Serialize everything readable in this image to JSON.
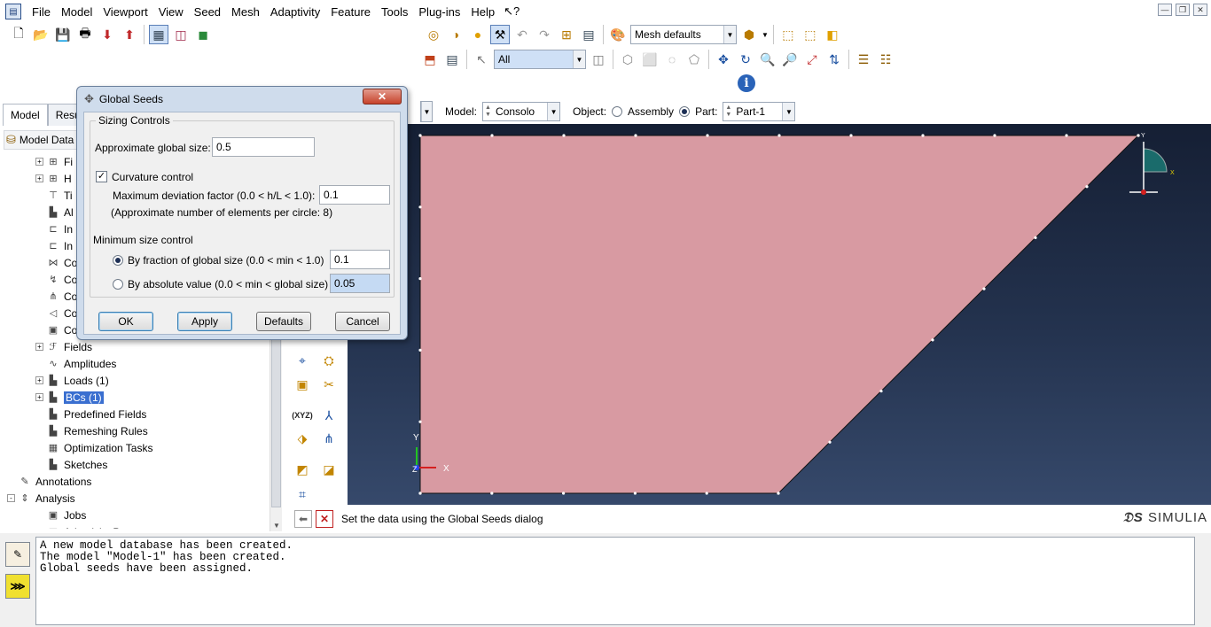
{
  "menu": [
    "File",
    "Model",
    "Viewport",
    "View",
    "Seed",
    "Mesh",
    "Adaptivity",
    "Feature",
    "Tools",
    "Plug-ins",
    "Help"
  ],
  "toolbar": {
    "mesh_defaults": "Mesh defaults",
    "selection_filter": "All"
  },
  "context_bar": {
    "model_label": "Model:",
    "model_value": "Consolo",
    "object_label": "Object:",
    "assembly_label": "Assembly",
    "part_label": "Part:",
    "part_value": "Part-1"
  },
  "left_panel": {
    "tabs": [
      "Model",
      "Resu"
    ],
    "tree_head": "Model Data",
    "tree": [
      {
        "label": "Fi",
        "indent": 1,
        "exp": "+",
        "icon": "step-icon"
      },
      {
        "label": "H",
        "indent": 1,
        "exp": "+",
        "icon": "history-icon"
      },
      {
        "label": "Ti",
        "indent": 1,
        "exp": "",
        "icon": "time-icon"
      },
      {
        "label": "Al",
        "indent": 1,
        "exp": "",
        "icon": "al-icon"
      },
      {
        "label": "In",
        "indent": 1,
        "exp": "",
        "icon": "interaction-icon"
      },
      {
        "label": "In",
        "indent": 1,
        "exp": "",
        "icon": "interaction-prop-icon"
      },
      {
        "label": "Co",
        "indent": 1,
        "exp": "",
        "icon": "constraint-icon"
      },
      {
        "label": "Co",
        "indent": 1,
        "exp": "",
        "icon": "connector-icon"
      },
      {
        "label": "Co",
        "indent": 1,
        "exp": "",
        "icon": "connector-section-icon"
      },
      {
        "label": "Co",
        "indent": 1,
        "exp": "",
        "icon": "contact-icon"
      },
      {
        "label": "Co",
        "indent": 1,
        "exp": "",
        "icon": "controls-icon"
      },
      {
        "label": "Fields",
        "indent": 1,
        "exp": "+",
        "icon": "fields-icon"
      },
      {
        "label": "Amplitudes",
        "indent": 1,
        "exp": "",
        "icon": "amplitude-icon"
      },
      {
        "label": "Loads (1)",
        "indent": 1,
        "exp": "+",
        "icon": "load-icon"
      },
      {
        "label": "BCs (1)",
        "indent": 1,
        "exp": "+",
        "icon": "bc-icon",
        "selected": true
      },
      {
        "label": "Predefined Fields",
        "indent": 1,
        "exp": "",
        "icon": "predefined-icon"
      },
      {
        "label": "Remeshing Rules",
        "indent": 1,
        "exp": "",
        "icon": "remesh-icon"
      },
      {
        "label": "Optimization Tasks",
        "indent": 1,
        "exp": "",
        "icon": "optimization-icon"
      },
      {
        "label": "Sketches",
        "indent": 1,
        "exp": "",
        "icon": "sketch-icon"
      },
      {
        "label": "Annotations",
        "indent": 0,
        "exp": "",
        "icon": "annotation-icon"
      },
      {
        "label": "Analysis",
        "indent": 0,
        "exp": "-",
        "icon": "analysis-icon"
      },
      {
        "label": "Jobs",
        "indent": 1,
        "exp": "",
        "icon": "job-icon"
      },
      {
        "label": "Adaptivity P",
        "indent": 1,
        "exp": "",
        "icon": "adaptivity-icon"
      }
    ]
  },
  "dialog": {
    "title": "Global Seeds",
    "close": "✕",
    "group_title": "Sizing Controls",
    "approx_size_label": "Approximate global size:",
    "approx_size_value": "0.5",
    "curvature_label": "Curvature control",
    "curvature_checked": true,
    "max_dev_label": "Maximum deviation factor (0.0 < h/L < 1.0):",
    "max_dev_value": "0.1",
    "approx_elements": "(Approximate number of elements per circle: 8)",
    "min_size_label": "Minimum size control",
    "fraction_label": "By fraction of global size  (0.0 < min < 1.0)",
    "fraction_value": "0.1",
    "absolute_label": "By absolute value  (0.0 < min < global size)",
    "absolute_value": "0.05",
    "buttons": {
      "ok": "OK",
      "apply": "Apply",
      "defaults": "Defaults",
      "cancel": "Cancel"
    }
  },
  "viewport": {
    "shape_color": "#d89aa2",
    "triad": {
      "x": "X",
      "y": "Y",
      "z": "Z"
    }
  },
  "status_prompt": "Set the data using the Global Seeds dialog",
  "brand": "SIMULIA",
  "messages": "A new model database has been created.\nThe model \"Model-1\" has been created.\nGlobal seeds have been assigned."
}
